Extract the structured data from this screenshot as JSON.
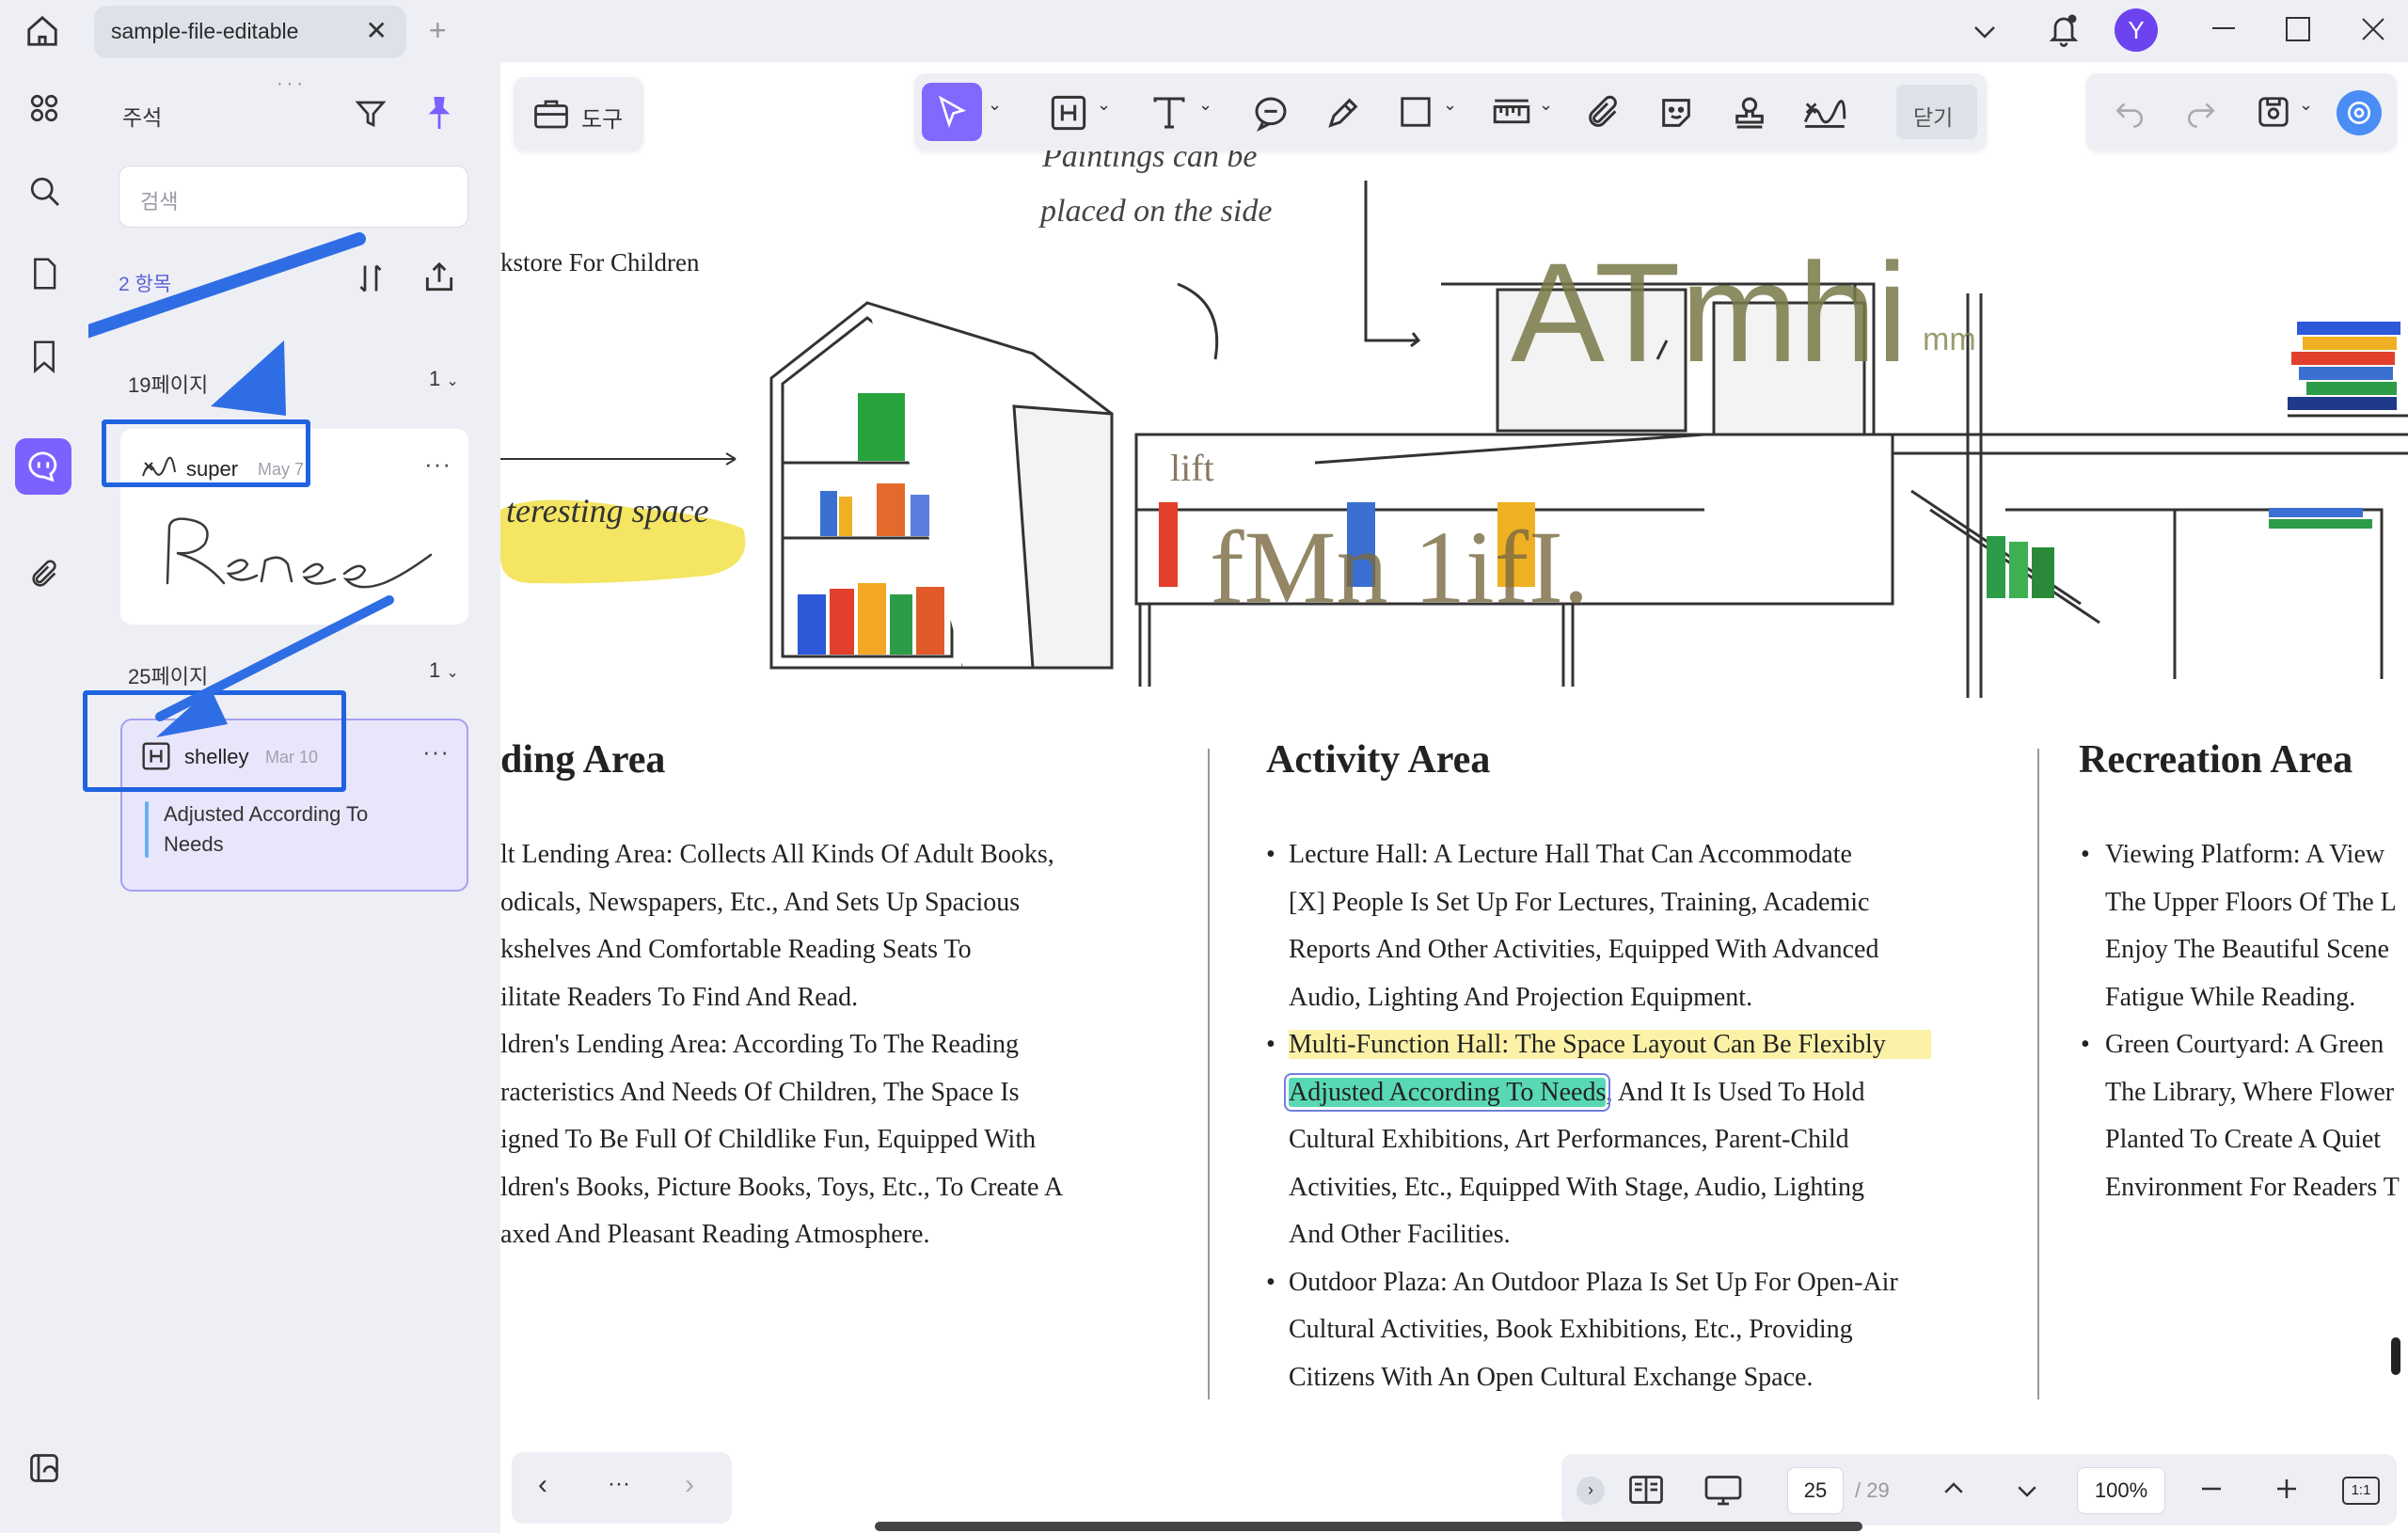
{
  "window": {
    "tab_title": "sample-file-editable",
    "avatar_letter": "Y"
  },
  "panel": {
    "title": "주석",
    "search_placeholder": "검색",
    "count": "2 항목",
    "groups": [
      {
        "page_label": "19페이지",
        "count": "1",
        "author": "super",
        "date": "May 7",
        "signature": "Renee"
      },
      {
        "page_label": "25페이지",
        "count": "1",
        "author": "shelley",
        "date": "Mar 10",
        "text": "Adjusted According To Needs"
      }
    ]
  },
  "toolbar": {
    "tools_label": "도구",
    "close_label": "닫기"
  },
  "document": {
    "illustration": {
      "label_bookstore": "kstore For Children",
      "label_paintings_1": "Paintings can be",
      "label_paintings_2": "placed on the side",
      "label_interesting": "teresting space",
      "overlay_large": "ATmhi",
      "overlay_small": "mm",
      "overlay_bottom": "fMn 1ifI.",
      "overlay_shelf": "lift"
    },
    "col1": {
      "heading": "ding Area",
      "lines": [
        "lt Lending Area: Collects All Kinds Of Adult Books,",
        "odicals, Newspapers, Etc., And Sets Up Spacious",
        "kshelves And Comfortable Reading Seats To",
        "ilitate Readers To Find And Read.",
        "ldren's Lending Area: According To The Reading",
        "racteristics And Needs Of Children, The Space Is",
        "igned To Be Full Of Childlike Fun, Equipped With",
        "ldren's Books, Picture Books, Toys, Etc., To Create A",
        "axed And Pleasant Reading Atmosphere."
      ]
    },
    "col2": {
      "heading": "Activity Area",
      "b1": [
        "Lecture Hall: A Lecture Hall That Can Accommodate",
        "[X] People Is Set Up For Lectures, Training, Academic",
        "Reports And Other Activities, Equipped With Advanced",
        "Audio, Lighting And Projection Equipment."
      ],
      "b2_first": "Multi-Function Hall: The Space Layout Can Be Flexibly",
      "b2_hl": "Adjusted According To Needs",
      "b2_rest": ", And It Is Used To Hold",
      "b2": [
        "Cultural Exhibitions, Art Performances, Parent-Child",
        "Activities, Etc., Equipped With Stage, Audio, Lighting",
        "And Other Facilities."
      ],
      "b3": [
        "Outdoor Plaza: An Outdoor Plaza Is Set Up For Open-Air",
        "Cultural Activities, Book Exhibitions, Etc., Providing",
        "Citizens With An Open Cultural Exchange Space."
      ]
    },
    "col3": {
      "heading": "Recreation Area",
      "b1": [
        "Viewing Platform: A View",
        "The Upper Floors Of The L",
        "Enjoy The Beautiful Scene",
        "Fatigue While Reading."
      ],
      "b2": [
        "Green Courtyard: A Green",
        "The Library, Where Flower",
        "Planted To Create A Quiet",
        "Environment For Readers T"
      ]
    }
  },
  "bottombar": {
    "current_page": "25",
    "total_pages": "/ 29",
    "zoom": "100%",
    "fit_label": "1:1",
    "more": "···"
  },
  "colors": {
    "accent": "#7b61ff",
    "annotation_box": "#1f63e0",
    "highlight_yellow": "#fbf2a8",
    "highlight_green": "#58d8b4"
  }
}
